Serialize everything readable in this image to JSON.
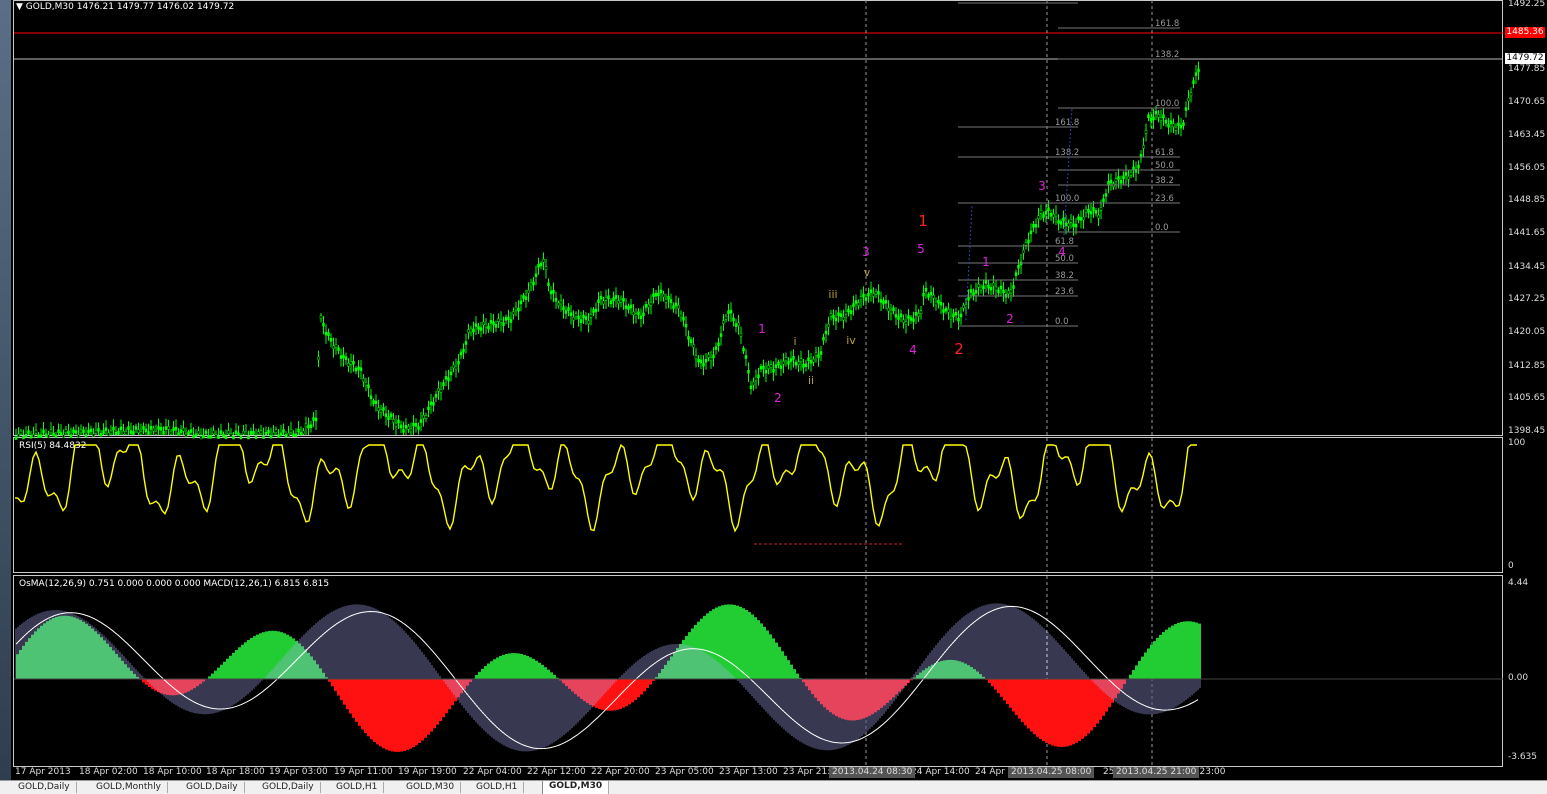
{
  "symbol_header": {
    "symbol": "GOLD,M30",
    "ohlc": "1476.21 1479.77 1476.02 1479.72"
  },
  "price_axis": {
    "ticks": [
      "1492.25",
      "1477.85",
      "1470.65",
      "1463.45",
      "1456.05",
      "1448.85",
      "1441.65",
      "1434.45",
      "1427.25",
      "1420.05",
      "1412.85",
      "1405.65",
      "1398.45"
    ],
    "red_line_label": "1485.36",
    "current_price_label": "1479.72"
  },
  "rsi_pane": {
    "label": "RSI(5) 84.4832",
    "top_label": "100",
    "bottom_label": "0"
  },
  "macd_pane": {
    "label": "OsMA(12,26,9) 0.751 0.000 0.000 0.000   MACD(12,26,1) 6.815 6.815",
    "top_label": "4.44",
    "mid_label": "0.00",
    "bottom_label": "-3.635"
  },
  "time_axis": {
    "labels": [
      "17 Apr 2013",
      "18 Apr 02:00",
      "18 Apr 10:00",
      "18 Apr 18:00",
      "19 Apr 03:00",
      "19 Apr 11:00",
      "19 Apr 19:00",
      "22 Apr 04:00",
      "22 Apr 12:00",
      "22 Apr 20:00",
      "23 Apr 05:00",
      "23 Apr 13:00",
      "23 Apr 21:",
      "24 Apr 14:00",
      "24 Apr ",
      "25 ",
      "r 23:00"
    ],
    "highlighted": [
      "2013.04.24 08:30",
      "2013.04.25 08:00",
      "2013.04.25 21:00"
    ]
  },
  "wave_labels": {
    "magenta": [
      "1",
      "2",
      "3",
      "4",
      "5",
      "1",
      "2",
      "3",
      "4"
    ],
    "olive": [
      "i",
      "ii",
      "iii",
      "iv",
      "v"
    ],
    "red": [
      "1",
      "2"
    ]
  },
  "fib_sets": [
    {
      "levels": [
        "161.8",
        "138.2",
        "100.0",
        "61.8",
        "50.0",
        "38.2",
        "23.6",
        "0.0"
      ]
    },
    {
      "levels": [
        "161.8",
        "138.2",
        "100.0",
        "61.8",
        "50.0",
        "38.2",
        "23.6",
        "0.0"
      ]
    }
  ],
  "tabs": [
    "GOLD,Daily",
    "GOLD,Monthly",
    "GOLD,Daily",
    "GOLD,Daily",
    "GOLD,H1",
    "GOLD,M30",
    "GOLD,H1",
    "GOLD,M30"
  ],
  "active_tab_index": 7,
  "colors": {
    "candle": "#00ff00",
    "rsi": "#ffff00",
    "osma_pos": "#22cc33",
    "osma_neg": "#ff1111",
    "macd": "#b0b0ff",
    "resistance": "#ff0000"
  }
}
